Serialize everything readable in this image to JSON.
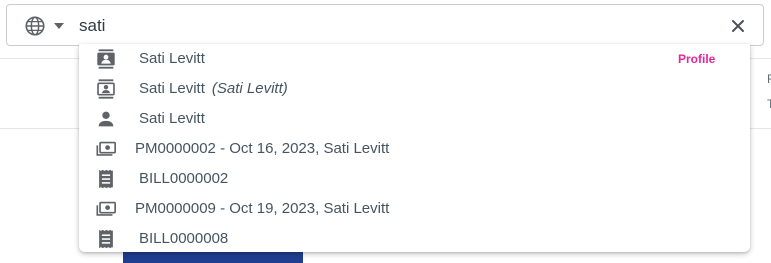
{
  "search": {
    "query": "sati"
  },
  "background": {
    "edge_text_1": "F",
    "edge_text_2": "T"
  },
  "suggestions": [
    {
      "icon": "contact-card-icon",
      "label": "Sati Levitt",
      "tag": "Profile"
    },
    {
      "icon": "contact-badge-icon",
      "label": "Sati Levitt",
      "alt": "(Sati Levitt)"
    },
    {
      "icon": "person-icon",
      "label": "Sati Levitt"
    },
    {
      "icon": "payment-icon",
      "label": "PM0000002 - Oct 16, 2023, Sati Levitt"
    },
    {
      "icon": "receipt-icon",
      "label": "BILL0000002"
    },
    {
      "icon": "payment-icon",
      "label": "PM0000009 - Oct 19, 2023, Sati Levitt"
    },
    {
      "icon": "receipt-icon",
      "label": "BILL0000008"
    }
  ],
  "colors": {
    "icon": "#5f6368",
    "text": "#455560",
    "profile_tag": "#e5259a",
    "background_block": "#1e3f8f"
  }
}
